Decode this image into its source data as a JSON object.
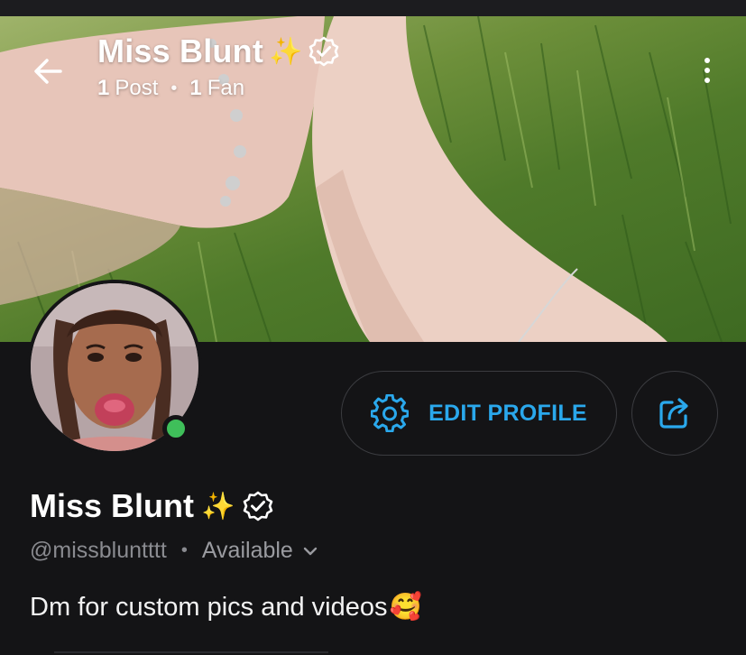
{
  "header": {
    "title": "Miss Blunt",
    "title_emoji": "✨",
    "posts_count": "1",
    "posts_label": "Post",
    "fans_count": "1",
    "fans_label": "Fan",
    "separator": "•"
  },
  "profile": {
    "name": "Miss Blunt",
    "name_emoji": "✨",
    "handle": "@missbluntttt",
    "separator": "•",
    "status": "Available",
    "bio": "Dm for custom pics and videos",
    "bio_emoji": "🥰",
    "online": true
  },
  "actions": {
    "edit_profile_label": "EDIT PROFILE"
  },
  "colors": {
    "background": "#141416",
    "accent": "#2aa8ec",
    "online": "#3fbf5a",
    "muted_text": "#8a8b90",
    "button_border": "#3b3c40"
  },
  "icons": {
    "back": "arrow-left-icon",
    "verified": "verified-badge-icon",
    "more": "more-vertical-icon",
    "settings": "gear-icon",
    "share": "share-icon",
    "dropdown": "chevron-down-icon"
  }
}
